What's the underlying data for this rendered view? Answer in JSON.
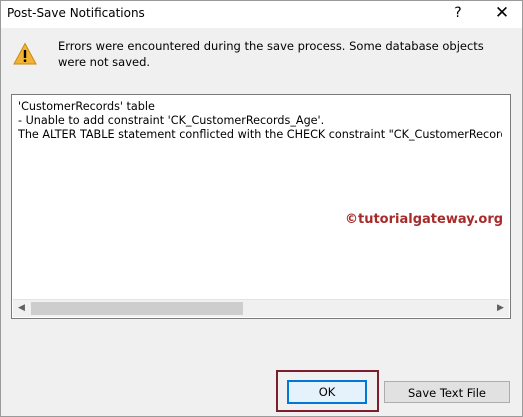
{
  "window": {
    "title": "Post-Save Notifications",
    "help_label": "?",
    "close_label": "✕"
  },
  "message": {
    "icon": "warning-icon",
    "text": "Errors were encountered during the save process. Some database objects were not saved."
  },
  "details": {
    "lines": [
      "'CustomerRecords' table",
      "- Unable to add constraint 'CK_CustomerRecords_Age'.",
      "The ALTER TABLE statement conflicted with the CHECK constraint \"CK_CustomerRecords_"
    ],
    "watermark": "©tutorialgateway.org"
  },
  "scrollbar": {
    "left_arrow": "◀",
    "right_arrow": "▶"
  },
  "buttons": {
    "ok_label": "OK",
    "save_text_file_label": "Save Text File"
  },
  "colors": {
    "highlight_border": "#7b1e2f",
    "watermark": "#a82b2b",
    "focus_border": "#0078d7",
    "warning_fill": "#f2b233"
  }
}
